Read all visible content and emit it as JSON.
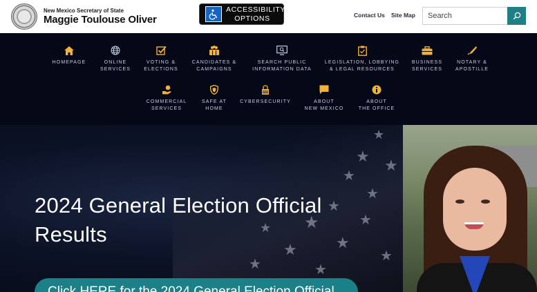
{
  "header": {
    "org_small": "New Mexico Secretary of State",
    "org_name": "Maggie Toulouse Oliver",
    "accessibility_label_line1": "ACCESSIBILITY",
    "accessibility_label_line2": "OPTIONS",
    "links": [
      "Contact Us",
      "Site Map"
    ],
    "search": {
      "placeholder": "Search",
      "value": ""
    },
    "accent_color": "#1f7f84"
  },
  "nav": {
    "items": [
      {
        "label": "HOMEPAGE",
        "icon": "home-icon"
      },
      {
        "label": "ONLINE\nSERVICES",
        "icon": "globe-icon"
      },
      {
        "label": "VOTING &\nELECTIONS",
        "icon": "ballot-check-icon"
      },
      {
        "label": "CANDIDATES &\nCAMPAIGNS",
        "icon": "people-icon"
      },
      {
        "label": "SEARCH PUBLIC\nINFORMATION DATA",
        "icon": "monitor-search-icon"
      },
      {
        "label": "LEGISLATION, LOBBYING\n& LEGAL RESOURCES",
        "icon": "clipboard-icon"
      },
      {
        "label": "BUSINESS\nSERVICES",
        "icon": "briefcase-icon"
      },
      {
        "label": "NOTARY &\nAPOSTILLE",
        "icon": "pen-icon"
      },
      {
        "label": "COMMERCIAL\nSERVICES",
        "icon": "hand-coin-icon"
      },
      {
        "label": "SAFE AT\nHOME",
        "icon": "shield-icon"
      },
      {
        "label": "CYBERSECURITY",
        "icon": "lock-icon"
      },
      {
        "label": "ABOUT\nNEW MEXICO",
        "icon": "speech-bubble-icon"
      },
      {
        "label": "ABOUT\nTHE OFFICE",
        "icon": "info-icon"
      }
    ],
    "icon_color": "#f2b233"
  },
  "hero": {
    "title": "2024 General Election Official Results",
    "cta": "Click HERE for the 2024 General Election Official"
  }
}
